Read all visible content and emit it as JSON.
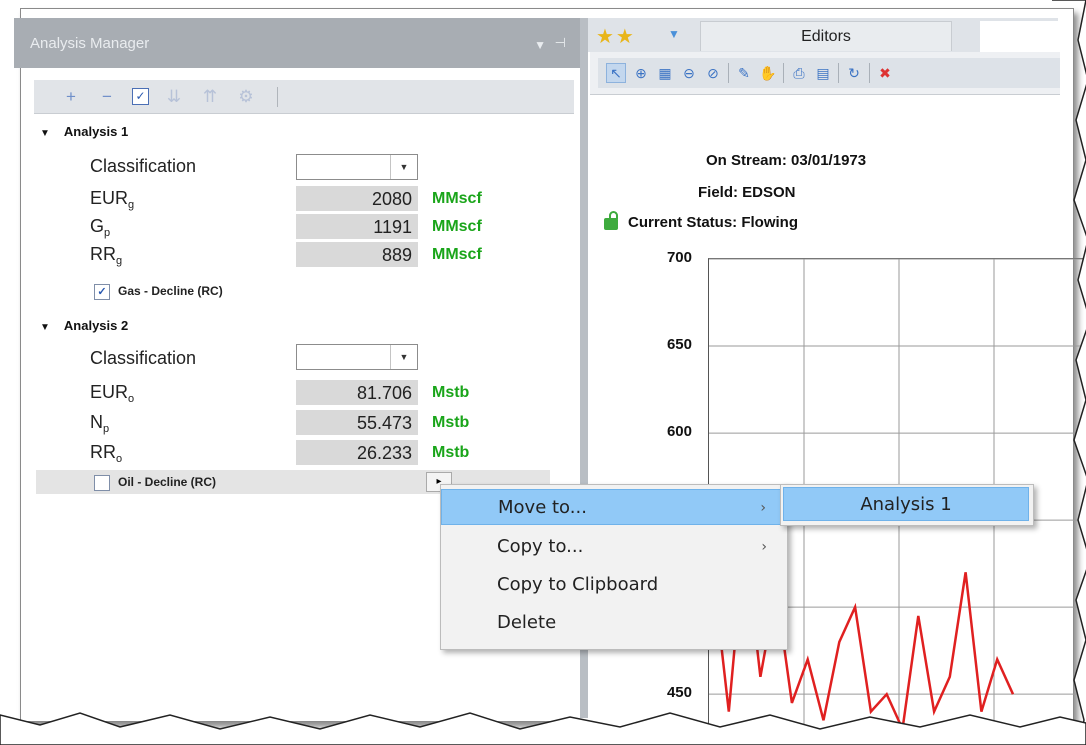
{
  "analysis_manager": {
    "title": "Analysis Manager",
    "toolbar": [
      "add-icon",
      "remove-icon",
      "check-icon",
      "expand-all-icon",
      "collapse-all-icon",
      "settings-icon"
    ],
    "groups": [
      {
        "title": "Analysis 1",
        "classification_label": "Classification",
        "classification_value": "",
        "rows": [
          {
            "label": "EUR",
            "sub": "g",
            "value": "2080",
            "unit": "MMscf"
          },
          {
            "label": "G",
            "sub": "p",
            "value": "1191",
            "unit": "MMscf"
          },
          {
            "label": "RR",
            "sub": "g",
            "value": "889",
            "unit": "MMscf"
          }
        ],
        "model": {
          "label": "Gas - Decline (RC)",
          "checked": true
        }
      },
      {
        "title": "Analysis 2",
        "classification_label": "Classification",
        "classification_value": "",
        "rows": [
          {
            "label": "EUR",
            "sub": "o",
            "value": "81.706",
            "unit": "Mstb"
          },
          {
            "label": "N",
            "sub": "p",
            "value": "55.473",
            "unit": "Mstb"
          },
          {
            "label": "RR",
            "sub": "o",
            "value": "26.233",
            "unit": "Mstb"
          }
        ],
        "model": {
          "label": "Oil - Decline (RC)",
          "checked": false
        }
      }
    ]
  },
  "editors": {
    "tab_label": "Editors",
    "info": {
      "on_stream": "On Stream: 03/01/1973",
      "field": "Field: EDSON",
      "status": "Current Status: Flowing"
    }
  },
  "chart_data": {
    "type": "line",
    "title": "",
    "xlabel": "",
    "ylabel": "",
    "yticks": [
      700,
      650,
      600,
      450
    ],
    "ylim": [
      430,
      700
    ],
    "series": [
      {
        "color": "#e02020",
        "values": [
          520,
          440,
          540,
          460,
          510,
          445,
          470,
          435,
          480,
          500,
          440,
          450,
          430,
          495,
          440,
          460,
          520,
          440,
          470,
          450
        ]
      }
    ]
  },
  "context_menu": {
    "items": [
      {
        "label": "Move to...",
        "has_submenu": true,
        "highlighted": true
      },
      {
        "label": "Copy to...",
        "has_submenu": true,
        "highlighted": false
      },
      {
        "label": "Copy to Clipboard",
        "has_submenu": false,
        "highlighted": false
      },
      {
        "label": "Delete",
        "has_submenu": false,
        "highlighted": false
      }
    ],
    "submenu": [
      "Analysis 1"
    ]
  },
  "colors": {
    "unit_green": "#1aa51a",
    "menu_highlight": "#91c9f7",
    "series_red": "#e02020"
  }
}
